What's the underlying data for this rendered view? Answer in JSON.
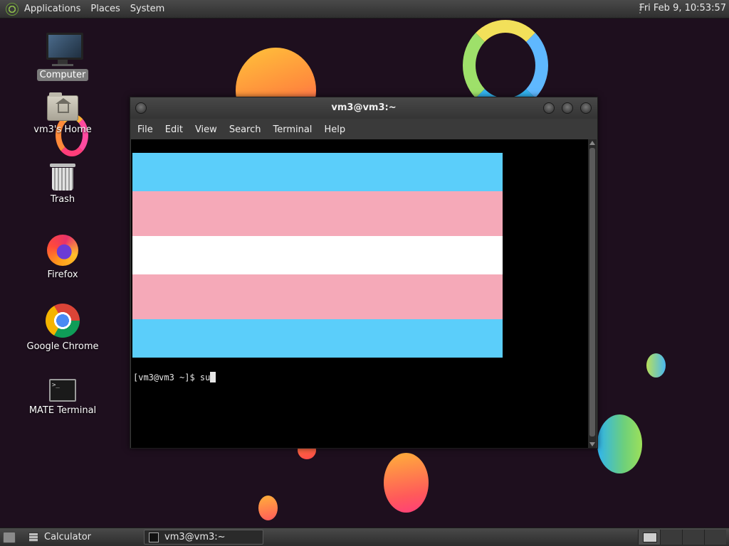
{
  "top_panel": {
    "menus": [
      "Applications",
      "Places",
      "System"
    ],
    "clock": "Fri Feb  9, 10:53:57"
  },
  "desktop_icons": [
    {
      "label": "Computer",
      "icon": "computer-icon"
    },
    {
      "label": "vm3's Home",
      "icon": "home-folder-icon"
    },
    {
      "label": "Trash",
      "icon": "trash-icon"
    },
    {
      "label": "Firefox",
      "icon": "firefox-icon"
    },
    {
      "label": "Google Chrome",
      "icon": "chrome-icon"
    },
    {
      "label": "MATE Terminal",
      "icon": "terminal-icon"
    }
  ],
  "terminal_window": {
    "title": "vm3@vm3:~",
    "menu": [
      "File",
      "Edit",
      "View",
      "Search",
      "Terminal",
      "Help"
    ],
    "prompt": "[vm3@vm3 ~]$ ",
    "typed": "su",
    "flag_colors": [
      "#5bcefa",
      "#f5a9b8",
      "#ffffff",
      "#f5a9b8",
      "#5bcefa"
    ]
  },
  "taskbar": {
    "tasks": [
      {
        "label": "Calculator",
        "icon": "calculator-icon"
      },
      {
        "label": "vm3@vm3:~",
        "icon": "terminal-icon"
      }
    ]
  },
  "colors": {
    "desktop_bg": "#1e0f1e",
    "terminal_bg": "#000000"
  }
}
